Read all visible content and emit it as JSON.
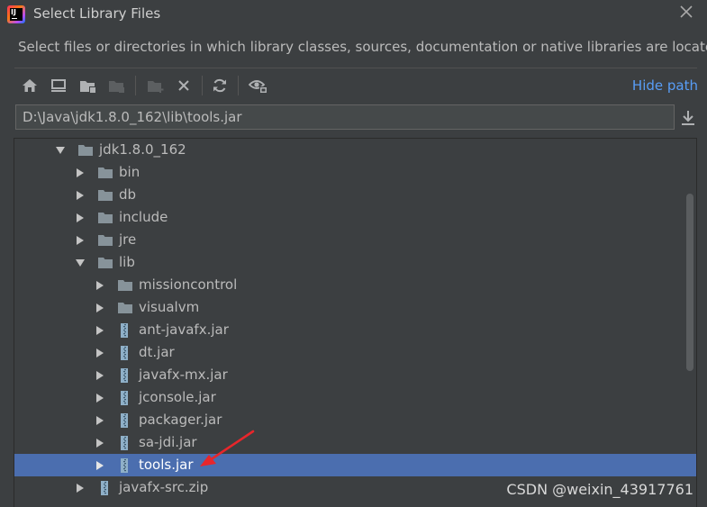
{
  "window": {
    "title": "Select Library Files",
    "description": "Select files or directories in which library classes, sources, documentation or native libraries are located"
  },
  "toolbar": {
    "buttons": [
      "home-icon",
      "desktop-icon",
      "project-folder-icon",
      "module-folder-icon",
      "new-folder-icon",
      "delete-icon",
      "refresh-icon",
      "show-hidden-icon"
    ],
    "hide_path_label": "Hide path"
  },
  "path": {
    "value": "D:\\Java\\jdk1.8.0_162\\lib\\tools.jar"
  },
  "tree": {
    "items": [
      {
        "label": "jdk1.8.0_162",
        "type": "folder",
        "expanded": true
      },
      {
        "label": "bin",
        "type": "folder",
        "expanded": false
      },
      {
        "label": "db",
        "type": "folder",
        "expanded": false
      },
      {
        "label": "include",
        "type": "folder",
        "expanded": false
      },
      {
        "label": "jre",
        "type": "folder",
        "expanded": false
      },
      {
        "label": "lib",
        "type": "folder",
        "expanded": true
      },
      {
        "label": "missioncontrol",
        "type": "folder",
        "expanded": false
      },
      {
        "label": "visualvm",
        "type": "folder",
        "expanded": false
      },
      {
        "label": "ant-javafx.jar",
        "type": "jar",
        "expanded": false
      },
      {
        "label": "dt.jar",
        "type": "jar",
        "expanded": false
      },
      {
        "label": "javafx-mx.jar",
        "type": "jar",
        "expanded": false
      },
      {
        "label": "jconsole.jar",
        "type": "jar",
        "expanded": false
      },
      {
        "label": "packager.jar",
        "type": "jar",
        "expanded": false
      },
      {
        "label": "sa-jdi.jar",
        "type": "jar",
        "expanded": false
      },
      {
        "label": "tools.jar",
        "type": "jar",
        "expanded": false,
        "selected": true
      },
      {
        "label": "javafx-src.zip",
        "type": "zip",
        "expanded": false
      }
    ]
  },
  "watermark": "CSDN @weixin_43917761",
  "colors": {
    "background": "#3c3f41",
    "selection": "#4b6eaf",
    "link": "#589df6",
    "annotation_arrow": "#e8262b"
  }
}
